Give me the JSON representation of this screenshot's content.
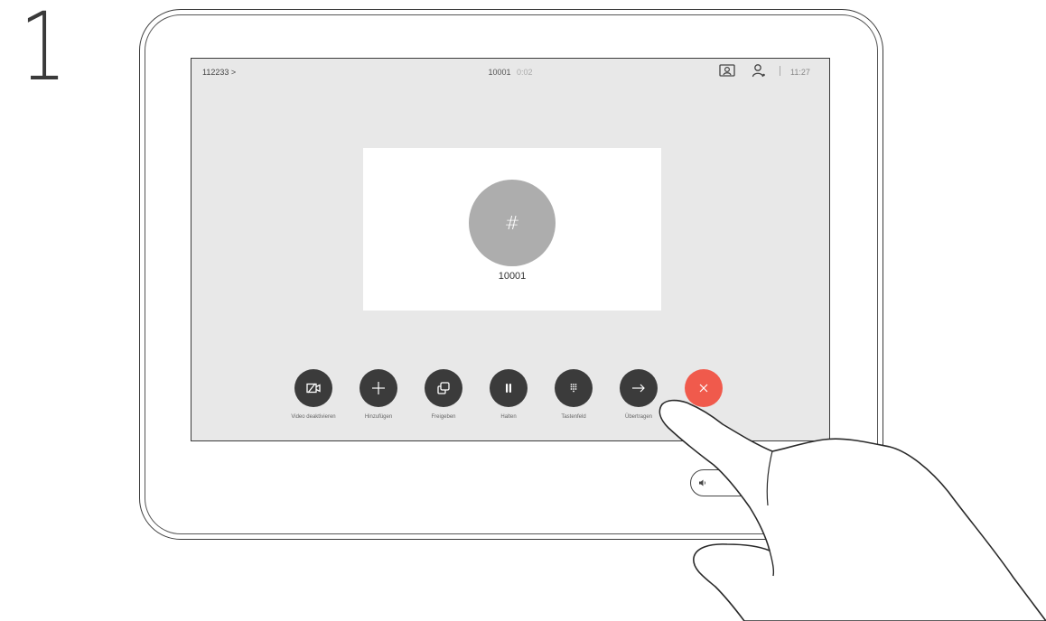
{
  "step": {
    "number": "1"
  },
  "statusbar": {
    "caller": "112233 >",
    "call_number": "10001",
    "call_timer": "0:02",
    "time": "11:27",
    "icons": [
      "selfview-icon",
      "person-icon"
    ]
  },
  "call_card": {
    "avatar_symbol": "#",
    "number": "10001"
  },
  "controls": [
    {
      "label": "Video deaktivieren",
      "icon": "video-off-icon"
    },
    {
      "label": "Hinzufügen",
      "icon": "plus-icon"
    },
    {
      "label": "Freigeben",
      "icon": "share-icon"
    },
    {
      "label": "Halten",
      "icon": "pause-icon"
    },
    {
      "label": "Tastenfeld",
      "icon": "keypad-icon"
    },
    {
      "label": "Übertragen",
      "icon": "arrow-right-icon"
    },
    {
      "label": "",
      "icon": "close-icon"
    }
  ],
  "colors": {
    "end_call": "#f05a4c",
    "control_button": "#3b3b3b",
    "screen_bg": "#e8e8e8"
  }
}
